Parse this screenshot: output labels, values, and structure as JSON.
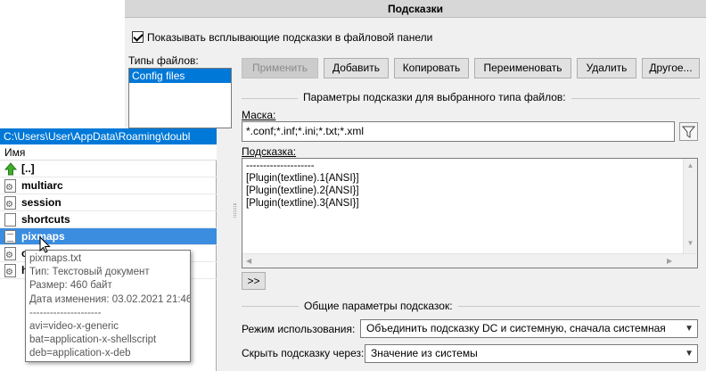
{
  "window": {
    "title": "Подсказки"
  },
  "show_hints": {
    "label": "Показывать всплывающие подсказки в файловой панели",
    "checked": true
  },
  "file_types": {
    "label": "Типы файлов:",
    "items": [
      "Config files"
    ]
  },
  "buttons": {
    "apply": "Применить",
    "add": "Добавить",
    "copy": "Копировать",
    "rename": "Переименовать",
    "delete": "Удалить",
    "other": "Другое..."
  },
  "params_group": {
    "title": "Параметры подсказки для выбранного типа файлов:"
  },
  "mask": {
    "label": "Маска:",
    "value": "*.conf;*.inf;*.ini;*.txt;*.xml"
  },
  "hint": {
    "label": "Подсказка:",
    "lines": [
      "--------------------",
      "[Plugin(textline).1{ANSI}]",
      "[Plugin(textline).2{ANSI}]",
      "[Plugin(textline).3{ANSI}]"
    ]
  },
  "macro_button": ">>",
  "general_group": {
    "title": "Общие параметры подсказок:"
  },
  "usage_mode": {
    "label": "Режим использования:",
    "value": "Объединить подсказку DC и системную, сначала системная"
  },
  "hide_after": {
    "label": "Скрыть подсказку через:",
    "value": "Значение из системы"
  },
  "panel": {
    "path": "C:\\Users\\User\\AppData\\Roaming\\doubl",
    "column_name": "Имя",
    "files": [
      {
        "name": "[..]",
        "icon": "up-arrow-icon",
        "selected": false
      },
      {
        "name": "multiarc",
        "icon": "config-file-icon",
        "selected": false
      },
      {
        "name": "session",
        "icon": "config-file-icon",
        "selected": false
      },
      {
        "name": "shortcuts",
        "icon": "text-file-icon",
        "selected": false
      },
      {
        "name": "pixmaps",
        "icon": "text-file-icon",
        "selected": true
      },
      {
        "name": "c",
        "icon": "config-file-icon",
        "selected": false
      },
      {
        "name": "h",
        "icon": "config-file-icon",
        "selected": false
      }
    ]
  },
  "tooltip": {
    "lines": [
      "pixmaps.txt",
      "Тип: Текстовый документ",
      "Размер: 460 байт",
      "Дата изменения: 03.02.2021 21:46",
      "---------------------",
      "avi=video-x-generic",
      "bat=application-x-shellscript",
      "deb=application-x-deb"
    ]
  }
}
